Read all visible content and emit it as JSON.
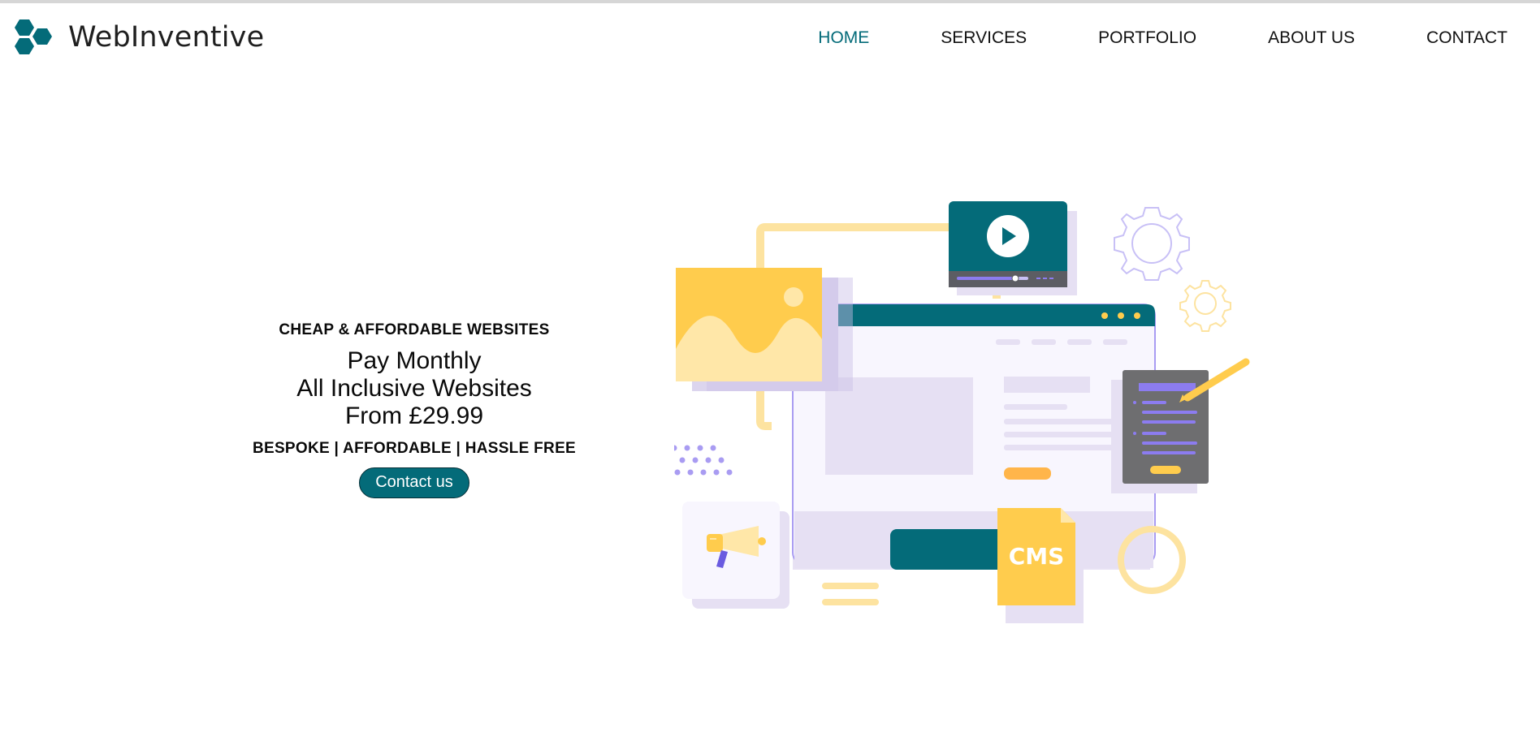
{
  "brand": {
    "name": "WebInventive",
    "logo_icon": "hexagon-cluster-icon",
    "color": "#046b79"
  },
  "nav": {
    "items": [
      {
        "label": "HOME",
        "active": true
      },
      {
        "label": "SERVICES",
        "active": false
      },
      {
        "label": "PORTFOLIO",
        "active": false
      },
      {
        "label": "ABOUT US",
        "active": false
      },
      {
        "label": "CONTACT",
        "active": false
      }
    ]
  },
  "hero": {
    "tagline": "CHEAP & AFFORDABLE WEBSITES",
    "headline": [
      "Pay Monthly",
      "All Inclusive Websites",
      "From £29.99"
    ],
    "features": "BESPOKE | AFFORDABLE | HASSLE FREE",
    "cta_label": "Contact us"
  },
  "illustration": {
    "cms_label": "CMS",
    "icons": [
      "browser-window-icon",
      "video-player-icon",
      "image-card-icon",
      "gear-icon",
      "document-pencil-icon",
      "megaphone-icon",
      "cms-file-icon"
    ]
  },
  "colors": {
    "accent": "#046b79",
    "yellow": "#ffcc4d",
    "lavender": "#e6e0f3",
    "purple": "#8c7cf0",
    "gray": "#6e6e70"
  }
}
